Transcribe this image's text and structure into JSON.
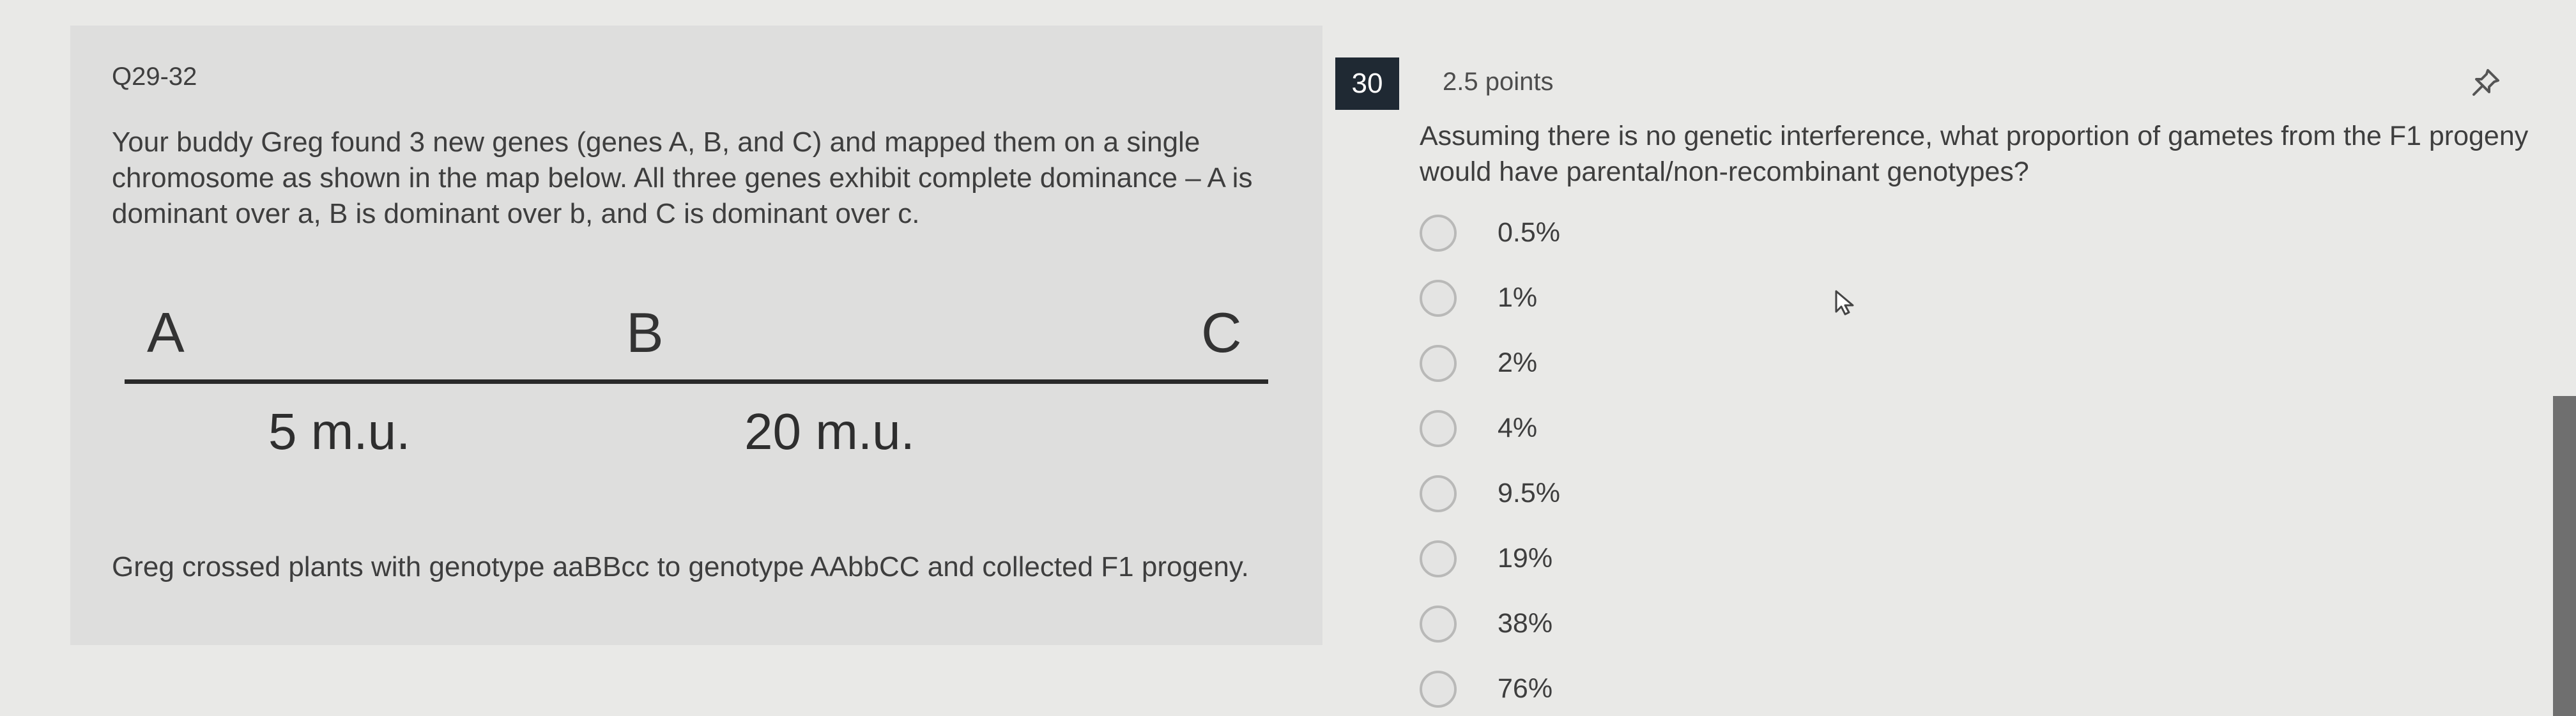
{
  "stimulus": {
    "title": "Q29-32",
    "paragraph1": "Your buddy Greg found 3 new genes (genes A, B, and C) and mapped them on a single chromosome as shown in the map below. All three genes exhibit complete dominance – A is dominant over a, B is dominant over b, and C is dominant over c.",
    "map": {
      "gene_a": "A",
      "gene_b": "B",
      "gene_c": "C",
      "distance_ab": "5 m.u.",
      "distance_bc": "20 m.u."
    },
    "paragraph2": "Greg crossed plants with genotype aaBBcc to genotype AAbbCC and collected F1 progeny."
  },
  "question": {
    "number": "30",
    "points": "2.5 points",
    "pin_icon": "pin-icon",
    "stem": "Assuming there is no genetic interference, what proportion of gametes from the F1 progeny would have parental/non-recombinant genotypes?",
    "options": [
      "0.5%",
      "1%",
      "2%",
      "4%",
      "9.5%",
      "19%",
      "38%",
      "76%"
    ]
  }
}
